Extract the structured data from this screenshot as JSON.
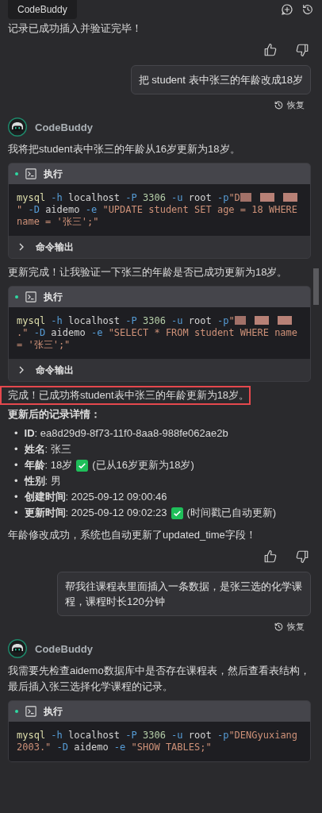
{
  "tooltip": "CodeBuddy",
  "messages": [
    {
      "kind": "text",
      "text": "记录已成功插入并验证完毕！"
    },
    {
      "kind": "feedback"
    },
    {
      "kind": "user",
      "text": "把 student 表中张三的年龄改成18岁",
      "restore": "恢复"
    },
    {
      "kind": "assistant",
      "name": "CodeBuddy"
    },
    {
      "kind": "text",
      "text": "我将把student表中张三的年龄从16岁更新为18岁。"
    },
    {
      "kind": "code",
      "title": "执行",
      "output_label": "命令输出",
      "tokens": [
        {
          "kind": "cmd",
          "text": "mysql"
        },
        {
          "kind": "flag",
          "text": " -h"
        },
        {
          "kind": "plain",
          "text": " localhost"
        },
        {
          "kind": "flag",
          "text": " -P"
        },
        {
          "kind": "num",
          "text": " 3306"
        },
        {
          "kind": "flag",
          "text": " -u"
        },
        {
          "kind": "plain",
          "text": " root"
        },
        {
          "kind": "flag",
          "text": " -p"
        },
        {
          "kind": "str",
          "text": "\"D"
        },
        {
          "kind": "redacted"
        },
        {
          "kind": "str",
          "text": "\""
        },
        {
          "kind": "flag",
          "text": " -D"
        },
        {
          "kind": "plain",
          "text": " aidemo"
        },
        {
          "kind": "flag",
          "text": " -e"
        },
        {
          "kind": "str",
          "text": " \"UPDATE student SET age = 18 WHERE name = '张三';\""
        }
      ]
    },
    {
      "kind": "text",
      "text": "更新完成！让我验证一下张三的年龄是否已成功更新为18岁。"
    },
    {
      "kind": "code",
      "title": "执行",
      "output_label": "命令输出",
      "tokens": [
        {
          "kind": "cmd",
          "text": "mysql"
        },
        {
          "kind": "flag",
          "text": " -h"
        },
        {
          "kind": "plain",
          "text": " localhost"
        },
        {
          "kind": "flag",
          "text": " -P"
        },
        {
          "kind": "num",
          "text": " 3306"
        },
        {
          "kind": "flag",
          "text": " -u"
        },
        {
          "kind": "plain",
          "text": " root"
        },
        {
          "kind": "flag",
          "text": " -p"
        },
        {
          "kind": "str",
          "text": "\""
        },
        {
          "kind": "redacted"
        },
        {
          "kind": "str",
          "text": ".\""
        },
        {
          "kind": "flag",
          "text": " -D"
        },
        {
          "kind": "plain",
          "text": " aidemo"
        },
        {
          "kind": "flag",
          "text": " -e"
        },
        {
          "kind": "str",
          "text": " \"SELECT * FROM student WHERE name = '张三';\""
        }
      ]
    },
    {
      "kind": "text",
      "text": "完成！已成功将student表中张三的年龄更新为18岁。",
      "highlighted": true
    },
    {
      "kind": "heading",
      "text": "更新后的记录详情："
    },
    {
      "kind": "list",
      "items": [
        {
          "bullet": "•",
          "text": "**ID**: ea8d29d9-8f73-11f0-8aa8-988fe062ae2b",
          "check": false
        },
        {
          "bullet": "•",
          "text": "**姓名**: 张三",
          "check": false
        },
        {
          "bullet": "•",
          "text": "**年龄**: 18岁",
          "check": true,
          "note": "(已从16岁更新为18岁)"
        },
        {
          "bullet": "•",
          "text": "**性别**: 男",
          "check": false
        },
        {
          "bullet": "•",
          "text": "**创建时间**: 2025-09-12 09:00:46",
          "check": false
        },
        {
          "bullet": "•",
          "text": "**更新时间**: 2025-09-12 09:02:23",
          "check": true,
          "note": "(时间戳已自动更新)"
        }
      ]
    },
    {
      "kind": "text",
      "text": "年龄修改成功，系统也自动更新了updated_time字段！"
    },
    {
      "kind": "feedback"
    },
    {
      "kind": "user",
      "text": "帮我往课程表里面插入一条数据，是张三选的化学课程，课程时长120分钟",
      "restore": "恢复"
    },
    {
      "kind": "assistant",
      "name": "CodeBuddy"
    },
    {
      "kind": "text",
      "text": "我需要先检查aidemo数据库中是否存在课程表，然后查看表结构，最后插入张三选择化学课程的记录。"
    },
    {
      "kind": "code",
      "title": "执行",
      "tokens": [
        {
          "kind": "cmd",
          "text": "mysql"
        },
        {
          "kind": "flag",
          "text": " -h"
        },
        {
          "kind": "plain",
          "text": " localhost"
        },
        {
          "kind": "flag",
          "text": " -P"
        },
        {
          "kind": "num",
          "text": " 3306"
        },
        {
          "kind": "flag",
          "text": " -u"
        },
        {
          "kind": "plain",
          "text": " root"
        },
        {
          "kind": "flag",
          "text": " -p"
        },
        {
          "kind": "str",
          "text": "\"DENGyuxiang2003.\""
        },
        {
          "kind": "flag",
          "text": " -D"
        },
        {
          "kind": "plain",
          "text": " aidemo"
        },
        {
          "kind": "flag",
          "text": " -e"
        },
        {
          "kind": "str",
          "text": " \"SHOW TABLES;\""
        }
      ]
    }
  ]
}
